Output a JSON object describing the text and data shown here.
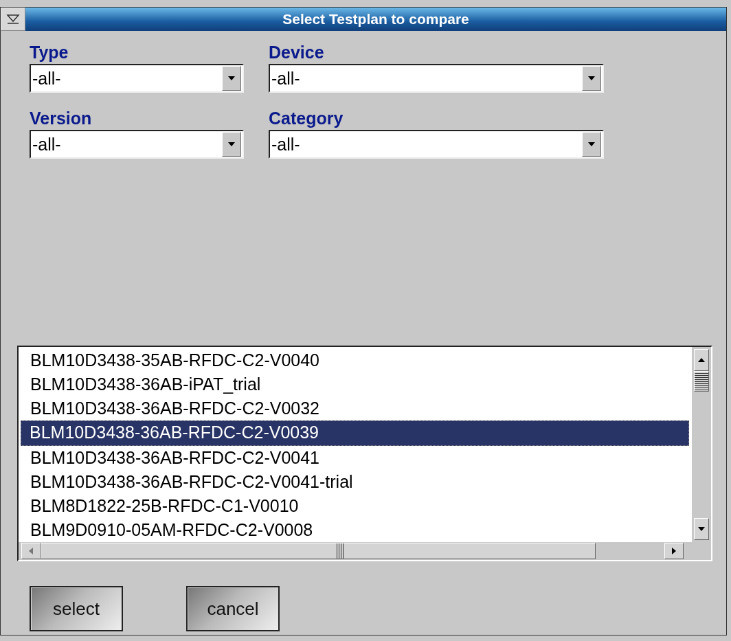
{
  "window": {
    "title": "Select Testplan to compare"
  },
  "filters": [
    {
      "label": "Type",
      "value": "-all-"
    },
    {
      "label": "Device",
      "value": "-all-"
    },
    {
      "label": "Version",
      "value": "-all-"
    },
    {
      "label": "Category",
      "value": "-all-"
    }
  ],
  "list": {
    "items": [
      {
        "text": "BLM10D3438-35AB-RFDC-C2-V0040",
        "selected": false
      },
      {
        "text": "BLM10D3438-36AB-iPAT_trial",
        "selected": false
      },
      {
        "text": "BLM10D3438-36AB-RFDC-C2-V0032",
        "selected": false
      },
      {
        "text": "BLM10D3438-36AB-RFDC-C2-V0039",
        "selected": true
      },
      {
        "text": "BLM10D3438-36AB-RFDC-C2-V0041",
        "selected": false
      },
      {
        "text": "BLM10D3438-36AB-RFDC-C2-V0041-trial",
        "selected": false
      },
      {
        "text": "BLM8D1822-25B-RFDC-C1-V0010",
        "selected": false
      },
      {
        "text": "BLM9D0910-05AM-RFDC-C2-V0008",
        "selected": false
      }
    ]
  },
  "buttons": [
    "select",
    "cancel"
  ]
}
